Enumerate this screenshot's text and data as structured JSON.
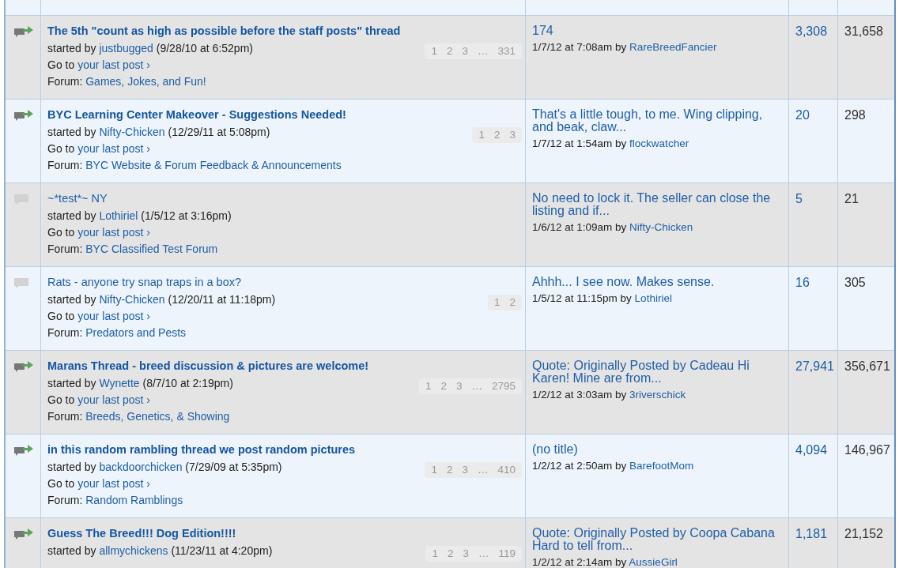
{
  "threads": [
    {
      "hot": true,
      "title": "The 5th \"count as high as possible before the staff posts\" thread",
      "started_by": "started by",
      "starter": "justbugged",
      "started": "(9/28/10 at 6:52pm)",
      "go_to": "Go to",
      "last_post_link": "your last post ›",
      "forum_label": "Forum:",
      "forum": "Games, Jokes, and Fun!",
      "pages": [
        "1",
        "2",
        "3",
        "…",
        "331"
      ],
      "last_snippet": "174",
      "last_time": "1/7/12 at 7:08am by",
      "last_user": "RareBreedFancier",
      "replies": "3,308",
      "views": "31,658"
    },
    {
      "hot": true,
      "title": "BYC Learning Center Makeover - Suggestions Needed!",
      "started_by": "started by",
      "starter": "Nifty-Chicken",
      "started": "(12/29/11 at 5:08pm)",
      "go_to": "Go to",
      "last_post_link": "your last post ›",
      "forum_label": "Forum:",
      "forum": "BYC Website & Forum Feedback & Announcements",
      "pages": [
        "1",
        "2",
        "3"
      ],
      "last_snippet": "That's a little tough, to me.  Wing clipping, and beak, claw...",
      "last_time": "1/7/12 at 1:54am by",
      "last_user": "flockwatcher",
      "replies": "20",
      "views": "298"
    },
    {
      "hot": false,
      "title": "~*test*~ NY",
      "started_by": "started by",
      "starter": "Lothiriel",
      "started": "(1/5/12 at 3:16pm)",
      "go_to": "Go to",
      "last_post_link": "your last post ›",
      "forum_label": "Forum:",
      "forum": "BYC Classified Test Forum",
      "last_snippet": "No need to lock it.  The seller can close the listing and if...",
      "last_time": "1/6/12 at 1:09am by",
      "last_user": "Nifty-Chicken",
      "replies": "5",
      "views": "21"
    },
    {
      "hot": false,
      "title": "Rats - anyone try snap traps in a box?",
      "started_by": "started by",
      "starter": "Nifty-Chicken",
      "started": "(12/20/11 at 11:18pm)",
      "go_to": "Go to",
      "last_post_link": "your last post ›",
      "forum_label": "Forum:",
      "forum": "Predators and Pests",
      "pages": [
        "1",
        "2"
      ],
      "last_snippet": "Ahhh... I see now. Makes sense.",
      "last_time": "1/5/12 at 11:15pm by",
      "last_user": "Lothiriel",
      "replies": "16",
      "views": "305"
    },
    {
      "hot": true,
      "title": "Marans Thread - breed discussion & pictures are welcome!",
      "started_by": "started by",
      "starter": "Wynette",
      "started": "(8/7/10 at 2:19pm)",
      "go_to": "Go to",
      "last_post_link": "your last post ›",
      "forum_label": "Forum:",
      "forum": "Breeds, Genetics, & Showing",
      "pages": [
        "1",
        "2",
        "3",
        "…",
        "2795"
      ],
      "last_snippet": "Quote: Originally Posted by Cadeau  Hi Karen! Mine are from...",
      "last_time": "1/2/12 at 3:03am by",
      "last_user": "3riverschick",
      "replies": "27,941",
      "views": "356,671"
    },
    {
      "hot": true,
      "title": "in this random rambling thread we post random pictures",
      "started_by": "started by",
      "starter": "backdoorchicken",
      "started": "(7/29/09 at 5:35pm)",
      "go_to": "Go to",
      "last_post_link": "your last post ›",
      "forum_label": "Forum:",
      "forum": "Random Ramblings",
      "pages": [
        "1",
        "2",
        "3",
        "…",
        "410"
      ],
      "last_snippet": "(no title)",
      "last_time": "1/2/12 at 2:50am by",
      "last_user": "BarefootMom",
      "replies": "4,094",
      "views": "146,967"
    },
    {
      "hot": true,
      "title": "Guess The Breed!!! Dog Edition!!!!",
      "started_by": "started by",
      "starter": "allmychickens",
      "started": "(11/23/11 at 4:20pm)",
      "pages": [
        "1",
        "2",
        "3",
        "…",
        "119"
      ],
      "last_snippet": "Quote: Originally Posted by Coopa Cabana Hard to tell from...",
      "last_time": "1/2/12 at 2:14am by",
      "last_user": "AussieGirl",
      "replies": "1,181",
      "views": "21,152"
    }
  ]
}
